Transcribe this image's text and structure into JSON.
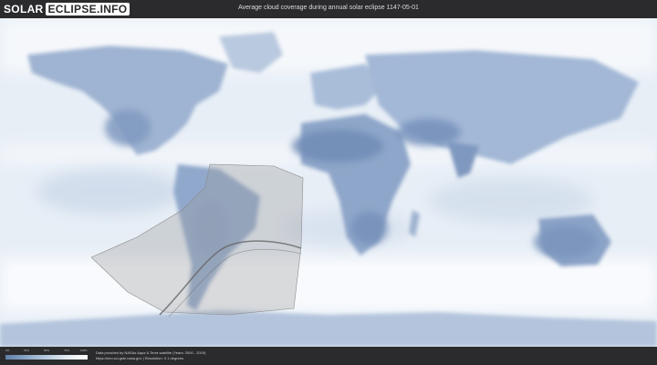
{
  "header": {
    "logo_left": "SOLAR",
    "logo_right": "ECLIPSE.INFO",
    "title": "Average cloud coverage during annual solar eclipse 1147-05-01"
  },
  "legend": {
    "ticks": [
      "0%",
      "25%",
      "50%",
      "75%",
      "100%"
    ],
    "colors": [
      "#5f7fa8",
      "#8aa5c6",
      "#b7c9de",
      "#e3ebf4",
      "#ffffff"
    ]
  },
  "credits": {
    "line1": "Data provided by NASAs Aqua & Terra satellite (Years: 2000 - 2019)",
    "line2": "https://neo.sci.gsfc.nasa.gov | Resolution: 0.1 degrees"
  },
  "map": {
    "projection": "equirectangular",
    "colors": {
      "ocean": "#e9eff6",
      "cloud_dense": "#ffffff",
      "land_dark": "#7e98bf",
      "land_mid": "#a6bbd7",
      "eclipse_zone": "#9a9a9a"
    }
  }
}
